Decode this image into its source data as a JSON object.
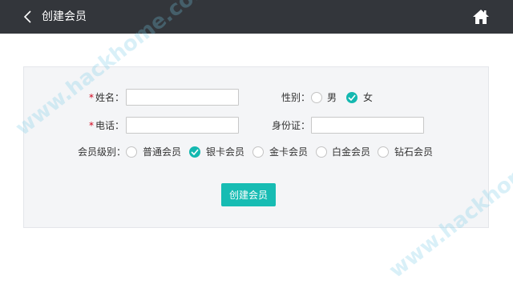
{
  "header": {
    "title": "创建会员",
    "back_icon": "back-arrow-icon",
    "home_icon": "home-icon"
  },
  "form": {
    "name": {
      "required_mark": "*",
      "label": "姓名：",
      "value": ""
    },
    "gender": {
      "label": "性别：",
      "options": [
        {
          "label": "男",
          "selected": false
        },
        {
          "label": "女",
          "selected": true
        }
      ]
    },
    "phone": {
      "required_mark": "*",
      "label": "电话：",
      "value": ""
    },
    "id_card": {
      "label": "身份证：",
      "value": ""
    },
    "level": {
      "label": "会员级别：",
      "options": [
        {
          "label": "普通会员",
          "selected": false
        },
        {
          "label": "银卡会员",
          "selected": true
        },
        {
          "label": "金卡会员",
          "selected": false
        },
        {
          "label": "白金会员",
          "selected": false
        },
        {
          "label": "钻石会员",
          "selected": false
        }
      ]
    },
    "submit_label": "创建会员"
  },
  "watermark": {
    "text": "www.hackhome.com"
  },
  "colors": {
    "topbar": "#33363b",
    "accent": "#17bcb3",
    "panel": "#f4f5f7",
    "required": "#d0021b"
  }
}
